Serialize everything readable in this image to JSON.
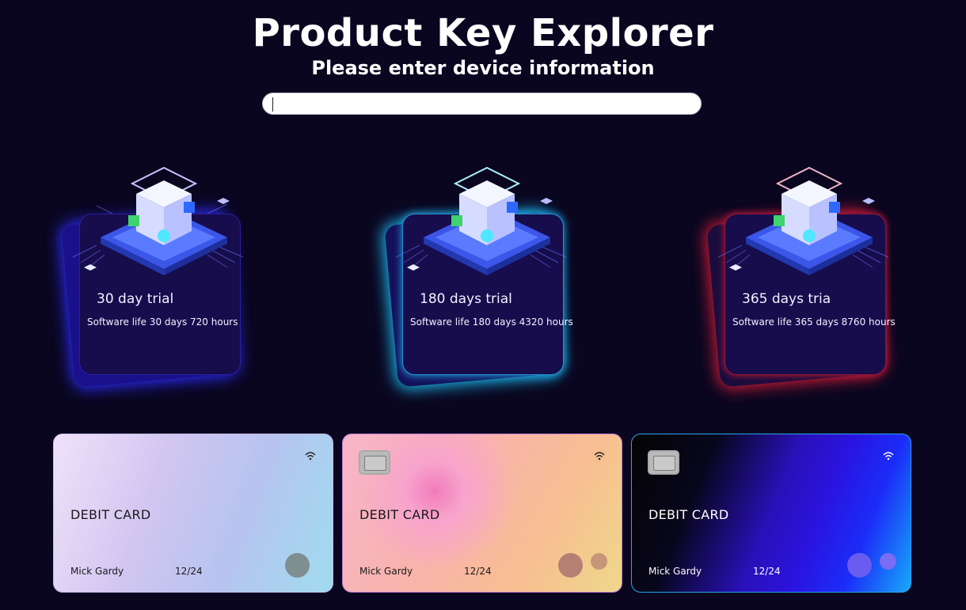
{
  "header": {
    "title": "Product Key Explorer",
    "subtitle": "Please enter device information"
  },
  "search": {
    "value": "",
    "placeholder": ""
  },
  "trials": [
    {
      "name": "30 day trial",
      "description": "Software life 30 days 720 hours",
      "glow": "#2a2bf0"
    },
    {
      "name": "180 days trial",
      "description": "Software life 180 days 4320 hours",
      "glow": "#1cb5e8"
    },
    {
      "name": "365 days tria",
      "description": "Software life 365 days 8760 hours",
      "glow": "#c61b37"
    }
  ],
  "cards": [
    {
      "type_label": "DEBIT CARD",
      "holder": "Mick Gardy",
      "expiry": "12/24",
      "has_chip": false,
      "circles": 1
    },
    {
      "type_label": "DEBIT CARD",
      "holder": "Mick Gardy",
      "expiry": "12/24",
      "has_chip": true,
      "circles": 2
    },
    {
      "type_label": "DEBIT CARD",
      "holder": "Mick Gardy",
      "expiry": "12/24",
      "has_chip": true,
      "circles": 2
    }
  ],
  "icons": {
    "contactless": "wifi-icon",
    "chip": "chip-icon",
    "trial_art": "cube-chip-icon"
  }
}
